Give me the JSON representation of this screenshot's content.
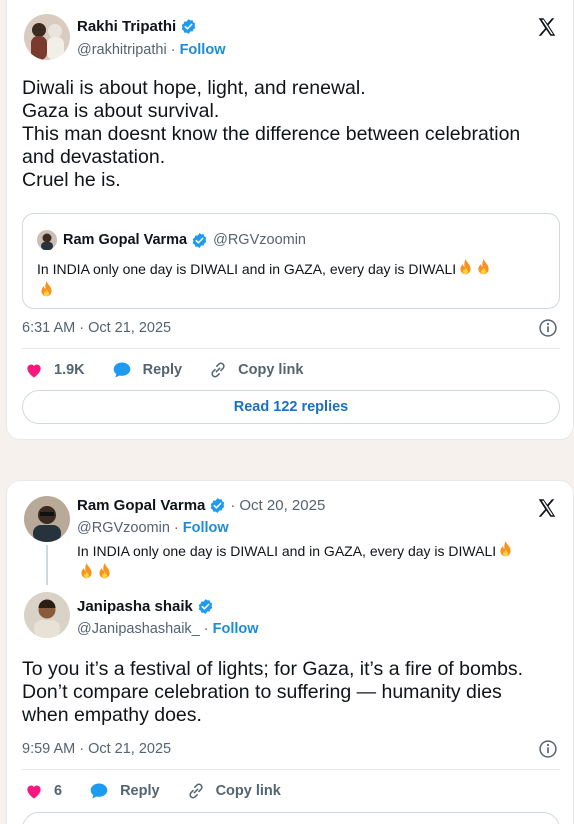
{
  "tweet1": {
    "author_name": "Rakhi Tripathi",
    "author_handle": "@rakhitripathi",
    "follow_label": "Follow",
    "text_lines": [
      "Diwali is about hope, light, and renewal.",
      "Gaza is about survival.",
      "This man doesnt know the difference between celebration",
      "and devastation.",
      "Cruel he is."
    ],
    "quote": {
      "author_name": "Ram Gopal Varma",
      "author_handle": "@RGVzoomin",
      "text": "In INDIA only one day is DIWALI and in GAZA, every day is DIWALI"
    },
    "timestamp": "6:31 AM · Oct 21, 2025",
    "likes": "1.9K",
    "reply_label": "Reply",
    "copy_link_label": "Copy link",
    "read_replies_label": "Read 122 replies"
  },
  "tweet2": {
    "parent": {
      "author_name": "Ram Gopal Varma",
      "date": "Oct 20, 2025",
      "author_handle": "@RGVzoomin",
      "follow_label": "Follow",
      "text": "In INDIA only one day is DIWALI and in GAZA, every day is DIWALI"
    },
    "reply": {
      "author_name": "Janipasha shaik",
      "author_handle": "@Janipashashaik_",
      "follow_label": "Follow",
      "text_lines": [
        "To you it’s a festival of lights; for Gaza, it’s a fire of bombs.",
        "Don’t compare celebration to suffering — humanity dies",
        "when empathy does."
      ],
      "timestamp": "9:59 AM · Oct 21, 2025",
      "likes": "6",
      "reply_label": "Reply",
      "copy_link_label": "Copy link"
    }
  },
  "icons": {
    "verified": "verified-badge-icon",
    "x_logo": "x-logo-icon",
    "heart": "heart-icon",
    "reply": "reply-bubble-icon",
    "link": "link-icon",
    "info": "info-icon",
    "fire": "fire-emoji-icon"
  },
  "colors": {
    "like": "#f91880",
    "reply": "#1d9bf0",
    "follow": "#1d8cd8",
    "verified": "#1d9bf0"
  }
}
